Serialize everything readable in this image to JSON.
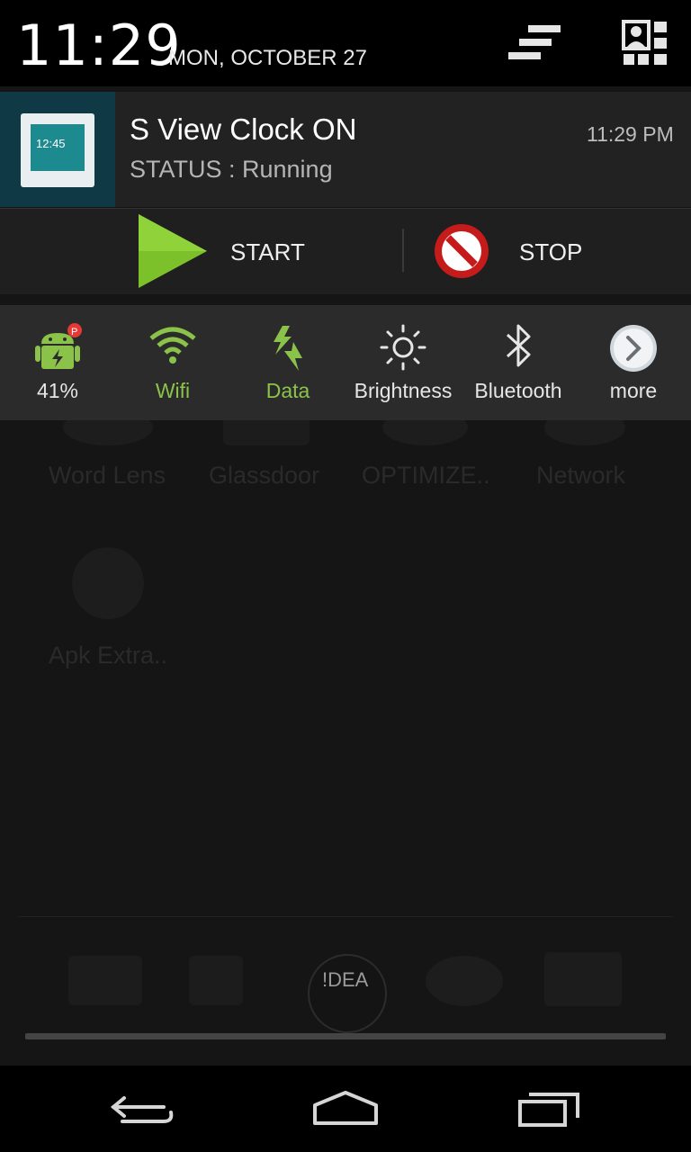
{
  "status_header": {
    "time": "11:29",
    "date": "MON, OCTOBER 27",
    "settings_icon": "quick-settings-icon",
    "user_icon": "user-grid-icon"
  },
  "notification": {
    "title": "S View Clock ON",
    "status": "STATUS : Running",
    "time": "11:29 PM",
    "thumb_time": "12:45",
    "actions": {
      "start_label": "START",
      "stop_label": "STOP"
    }
  },
  "quick_toggles": [
    {
      "label": "41%",
      "icon": "battery-android-icon"
    },
    {
      "label": "Wifi",
      "icon": "wifi-icon"
    },
    {
      "label": "Data",
      "icon": "data-icon"
    },
    {
      "label": "Brightness",
      "icon": "brightness-icon"
    },
    {
      "label": "Bluetooth",
      "icon": "bluetooth-icon"
    },
    {
      "label": "more",
      "icon": "chevron-right-icon"
    }
  ],
  "background_apps": {
    "row1": [
      "Word Lens",
      "Glassdoor",
      "OPTIMIZE..",
      "Network"
    ],
    "row2": [
      "Apk Extra.."
    ],
    "dock_label": "!DEA"
  },
  "colors": {
    "accent_green": "#8bc34a",
    "header_bg": "#000000",
    "notification_bg": "#222222",
    "toggles_bg": "#2b2b2b"
  }
}
